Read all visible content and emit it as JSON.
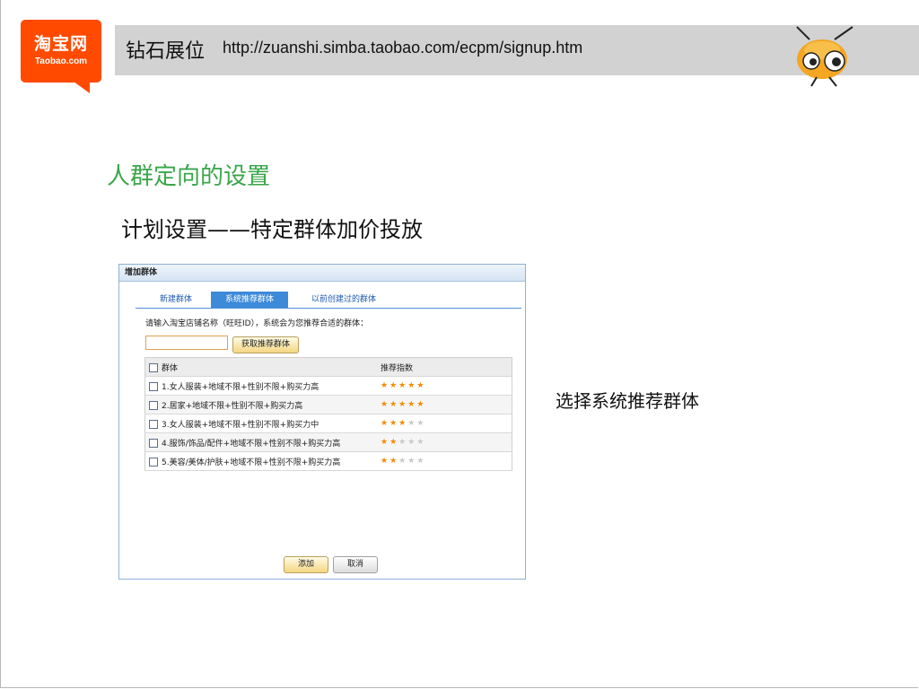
{
  "header": {
    "title": "钻石展位",
    "url": "http://zuanshi.simba.taobao.com/ecpm/signup.htm"
  },
  "logo": {
    "cn": "淘宝网",
    "en": "Taobao.com",
    "color": "#ff4a00"
  },
  "mascot_icon": "ant-mascot-icon",
  "section_title": "人群定向的设置",
  "subtitle": "计划设置——特定群体加价投放",
  "side_note": "选择系统推荐群体",
  "dialog": {
    "title": "增加群体",
    "tabs": [
      {
        "label": "新建群体"
      },
      {
        "label": "系统推荐群体",
        "active": true
      },
      {
        "label": "以前创建过的群体"
      }
    ],
    "prompt": "请输入淘宝店铺名称（旺旺ID），系统会为您推荐合适的群体：",
    "input_value": "",
    "fetch_button": "获取推荐群体",
    "table": {
      "headers": [
        "群体",
        "推荐指数"
      ],
      "rows": [
        {
          "label": "1.女人服装+地域不限+性别不限+购买力高",
          "stars": 5
        },
        {
          "label": "2.居家+地域不限+性别不限+购买力高",
          "stars": 5
        },
        {
          "label": "3.女人服装+地域不限+性别不限+购买力中",
          "stars": 3
        },
        {
          "label": "4.服饰/饰品/配件+地域不限+性别不限+购买力高",
          "stars": 2
        },
        {
          "label": "5.美容/美体/护肤+地域不限+性别不限+购买力高",
          "stars": 2
        }
      ],
      "max_stars": 5
    },
    "add_button": "添加",
    "cancel_button": "取消"
  },
  "colors": {
    "header_band": "#d2d2d2",
    "section_title": "#3aa64a",
    "active_tab": "#3d8ad9",
    "star_on": "#f28a00",
    "star_off": "#c8c8c8"
  }
}
